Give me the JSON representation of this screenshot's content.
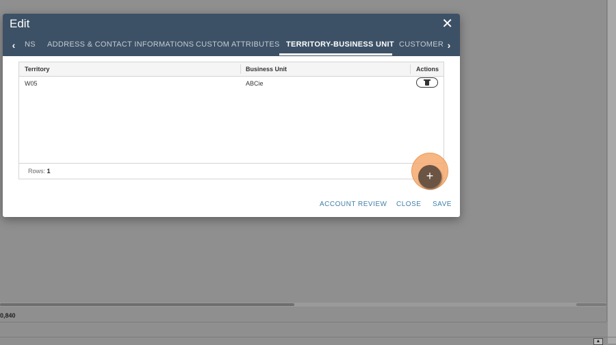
{
  "background": {
    "footer_value": "0,840",
    "bottom_icon": "▲"
  },
  "dialog": {
    "title": "Edit",
    "close_icon": "✕",
    "tab_prev_icon": "‹",
    "tab_next_icon": "›",
    "tabs": [
      {
        "label": "NS",
        "active": false
      },
      {
        "label": "ADDRESS & CONTACT INFORMATIONS",
        "active": false
      },
      {
        "label": "CUSTOM ATTRIBUTES",
        "active": false
      },
      {
        "label": "TERRITORY-BUSINESS UNIT",
        "active": true
      },
      {
        "label": "CUSTOMER",
        "active": false
      }
    ]
  },
  "grid": {
    "columns": [
      "Territory",
      "Business Unit",
      "Actions"
    ],
    "rows": [
      {
        "territory": "W05",
        "business_unit": "ABCie",
        "action_icon": "trash-icon"
      }
    ],
    "rows_label": "Rows:",
    "rows_count": "1"
  },
  "fab": {
    "icon": "+"
  },
  "actions": {
    "account_review": "ACCOUNT REVIEW",
    "close": "CLOSE",
    "save": "SAVE"
  },
  "colors": {
    "header": "#3d5166",
    "action_link": "#3f7fa8",
    "fab": "#6b5444",
    "fab_halo": "#f4aa6e"
  }
}
